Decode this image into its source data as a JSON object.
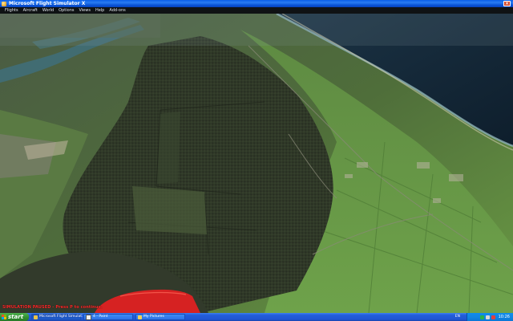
{
  "window": {
    "title": "Microsoft Flight Simulator X",
    "close_glyph": "×"
  },
  "menu": {
    "items": [
      "Flights",
      "Aircraft",
      "World",
      "Options",
      "Views",
      "Help",
      "Add-ons"
    ]
  },
  "sim": {
    "status_text": "SIMULATION PAUSED - Press P to continue."
  },
  "taskbar": {
    "start_label": "start",
    "tasks": [
      {
        "label": "Microsoft Flight Simulat...",
        "icon": "fsx-icon"
      },
      {
        "label": "4 - Paint",
        "icon": "paint-icon"
      },
      {
        "label": "My Pictures",
        "icon": "folder-icon"
      }
    ],
    "language": "EN",
    "clock": "10:26"
  },
  "colors": {
    "sea": "#14283a",
    "forest": "#2c3526",
    "farmland": "#5f8a3e",
    "aircraft_wing": "#d62222"
  }
}
